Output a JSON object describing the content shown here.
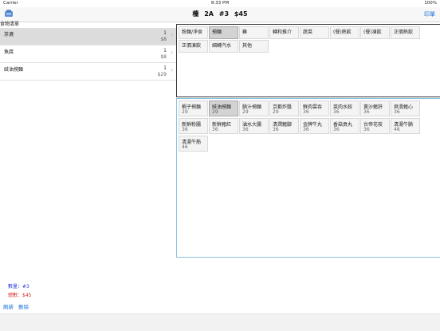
{
  "status": {
    "carrier": "Carrier",
    "time": "8:33 PM",
    "battery": "100%"
  },
  "nav": {
    "table": "檯",
    "table_no": "2A",
    "order_no": "#3",
    "amount": "$45",
    "print_label": "印單"
  },
  "order": {
    "header": "食物清單",
    "items": [
      {
        "name": "芽漉",
        "qty": "1",
        "price": "$8",
        "selected": true
      },
      {
        "name": "魚腐",
        "qty": "1",
        "price": "$8",
        "selected": false
      },
      {
        "name": "豉油撈麵",
        "qty": "1",
        "price": "$29",
        "selected": false
      }
    ]
  },
  "categories": [
    {
      "label": "粉麵/淨食",
      "selected": false
    },
    {
      "label": "撈麵",
      "selected": true
    },
    {
      "label": "雞",
      "selected": false
    },
    {
      "label": "轉和推介",
      "selected": false
    },
    {
      "label": "蔬菜",
      "selected": false
    },
    {
      "label": "(餐)熱飲",
      "selected": false
    },
    {
      "label": "(餐)凍飲",
      "selected": false
    },
    {
      "label": "正價熱飲",
      "selected": false
    },
    {
      "label": "正價凍飲",
      "selected": false
    },
    {
      "label": "細轉汽水",
      "selected": false
    },
    {
      "label": "其他",
      "selected": false
    }
  ],
  "menu_items": [
    {
      "name": "蝦子撈麵",
      "price": "29",
      "selected": false
    },
    {
      "name": "豉油撈麵",
      "price": "29",
      "selected": true
    },
    {
      "name": "腩汁撈麵",
      "price": "29",
      "selected": false
    },
    {
      "name": "京都炸醬",
      "price": "29",
      "selected": false
    },
    {
      "name": "鮮肉雲吞",
      "price": "36",
      "selected": false
    },
    {
      "name": "菜肉水餃",
      "price": "36",
      "selected": false
    },
    {
      "name": "黃沙豬肝",
      "price": "36",
      "selected": false
    },
    {
      "name": "爽滑豬心",
      "price": "36",
      "selected": false
    },
    {
      "name": "新鮮粉腸",
      "price": "36",
      "selected": false
    },
    {
      "name": "新鮮豬紅",
      "price": "36",
      "selected": false
    },
    {
      "name": "滷水大腸",
      "price": "36",
      "selected": false
    },
    {
      "name": "清潤豬腳",
      "price": "36",
      "selected": false
    },
    {
      "name": "金牌牛丸",
      "price": "36",
      "selected": false
    },
    {
      "name": "香菇貢丸",
      "price": "36",
      "selected": false
    },
    {
      "name": "台帝花枝",
      "price": "36",
      "selected": false
    },
    {
      "name": "清湯牛腩",
      "price": "46",
      "selected": false
    },
    {
      "name": "清湯牛筋",
      "price": "46",
      "selected": false
    }
  ],
  "summary": {
    "count_label": "數量：#3",
    "total_label": "總數：$45"
  },
  "actions": {
    "refresh": "刷新",
    "delete": "刪除"
  },
  "colors": {
    "accent": "#1a73d9",
    "count": "#2b3bd6",
    "total": "#d62b2b",
    "panel_border": "#8bc0df"
  }
}
